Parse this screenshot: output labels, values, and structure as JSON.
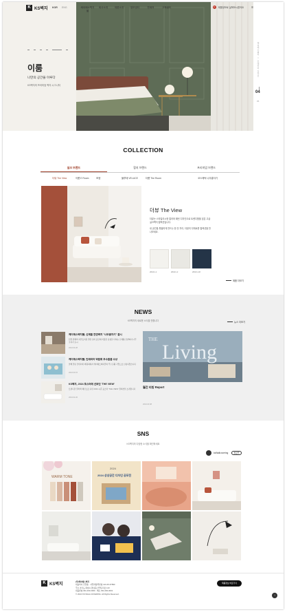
{
  "header": {
    "logo_mark": "K",
    "logo_text": "KS벽지",
    "lang_kr": "KOR",
    "lang_en": "ENG",
    "nav": [
      "케이에스벽지몰",
      "회사소개",
      "제품소개",
      "정보센터",
      "판매처",
      "고객센터"
    ],
    "cart_count": "0",
    "cart_label": "제품정보로 살펴보시겠어요"
  },
  "hero": {
    "title": "이룸",
    "subtitle": "나만의 공간을 이루다",
    "code": "KS벽지의 프리미엄 벽지 시그니처",
    "side_label": "케이에스벽지 × 인테리어 디자인",
    "page_current": "04",
    "page_total": "05"
  },
  "collection": {
    "title": "COLLECTION",
    "tabs": [
      "실크 브랜드",
      "합지 브랜드",
      "프리미엄 브랜드"
    ],
    "subtabs": [
      "더뷰 The View",
      "이룸 E Room",
      "포엠",
      "블루테 VELUCE",
      "더룸 The Room",
      "코스메틱 나무홍자기"
    ],
    "card_title": "더뷰 The View",
    "desc1": "더뷰는 스타일리시한 컬러와 패턴 디자인으로 트렌디함을 담은 고급 실크벽지 컬렉션입니다.",
    "desc2": "내 공간을 특별하게 만드는 한 끗 차이, 더뷰의 다채로운 컬렉션을 만나보세요.",
    "swatch_labels": [
      "26101-1",
      "26101-2",
      "26101-18"
    ],
    "swatch_colors": [
      "#f3f2ee",
      "#e9e8e3",
      "#243447"
    ],
    "more": "제품 더보기"
  },
  "news": {
    "title": "NEWS",
    "subtitle": "KS벽지의 새로운 소식을 전합니다",
    "more": "뉴스 더보기",
    "items": [
      {
        "title": "케이에스벽지몰, 신제품 전면벽지 \"나무홍자기\" 출시",
        "desc": "천연 원목의 자연스러운 결을 담아 공간에 따뜻한 감성을 더하는 신제품 전면벽지 나무홍자기 출시",
        "date": "2024.03.28"
      },
      {
        "title": "케이에스벽지몰, 인테리어 박람회 우수출품 수상",
        "desc": "올해 열린 인테리어 박람회에서 케이에스벽지몰이 우수출품 기업으로 선정되었습니다",
        "date": "2024.03.15"
      },
      {
        "title": "KS벽지, 2024 포스터에 선보인 'THE VIEW'",
        "desc": "트렌디한 컬러와 패턴으로 꾸민 2024 시즌 포스터 'THE VIEW' 컬렉션을 소개합니다",
        "date": "2024.02.26"
      }
    ],
    "feature_title": "월간 리빙 Report",
    "feature_date": "2024.03.08",
    "feature_word": "Living",
    "feature_word_small": "THE"
  },
  "sns": {
    "title": "SNS",
    "subtitle": "KS벽지의 다양한 소식을 확인하세요",
    "handle": "ksWallcovering",
    "follow": "팔로우",
    "tile_warm": "WARM TONE",
    "tile_event": "2024 상상공간 디자인 공모전",
    "tile_event_year": "2024"
  },
  "footer": {
    "company": "(주)케이에스벽지",
    "lines": [
      "대표이사 홍길동 · 사업자등록번호 123-45-67890",
      "주소 경기도 화성시 향남읍 산업단지로 123",
      "대표번호 031-000-0000 · 팩스 031-000-0001",
      "© 2024 KS WALLCOVERING. All Rights Reserved."
    ],
    "button": "제품정보 바로가기",
    "top": "↑"
  }
}
